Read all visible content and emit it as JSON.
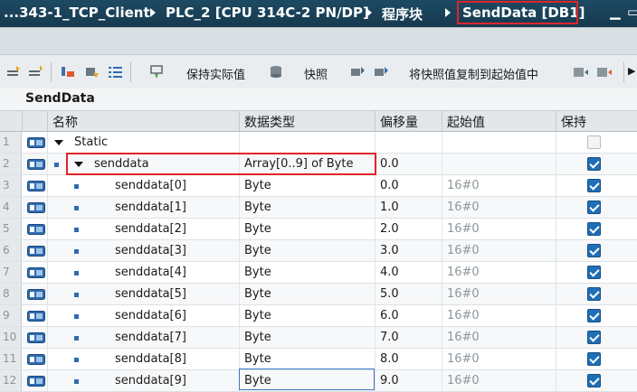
{
  "breadcrumb": {
    "items": [
      "...343-1_TCP_Client",
      "PLC_2 [CPU 314C-2 PN/DP]",
      "程序块",
      "SendData [DB1]"
    ]
  },
  "toolbar": {
    "keep_actual_label": "保持实际值",
    "snapshot_label": "快照",
    "copy_snapshot_label": "将快照值复制到起始值中"
  },
  "block": {
    "name": "SendData"
  },
  "table": {
    "headers": {
      "name": "名称",
      "datatype": "数据类型",
      "offset": "偏移量",
      "start": "起始值",
      "retain": "保持"
    },
    "rows": [
      {
        "num": "1",
        "name": "Static",
        "type": "",
        "offset": "",
        "start": "",
        "retain": false
      },
      {
        "num": "2",
        "name": "senddata",
        "type": "Array[0..9] of Byte",
        "offset": "0.0",
        "start": "",
        "retain": true
      },
      {
        "num": "3",
        "name": "senddata[0]",
        "type": "Byte",
        "offset": "0.0",
        "start": "16#0",
        "retain": true
      },
      {
        "num": "4",
        "name": "senddata[1]",
        "type": "Byte",
        "offset": "1.0",
        "start": "16#0",
        "retain": true
      },
      {
        "num": "5",
        "name": "senddata[2]",
        "type": "Byte",
        "offset": "2.0",
        "start": "16#0",
        "retain": true
      },
      {
        "num": "6",
        "name": "senddata[3]",
        "type": "Byte",
        "offset": "3.0",
        "start": "16#0",
        "retain": true
      },
      {
        "num": "7",
        "name": "senddata[4]",
        "type": "Byte",
        "offset": "4.0",
        "start": "16#0",
        "retain": true
      },
      {
        "num": "8",
        "name": "senddata[5]",
        "type": "Byte",
        "offset": "5.0",
        "start": "16#0",
        "retain": true
      },
      {
        "num": "9",
        "name": "senddata[6]",
        "type": "Byte",
        "offset": "6.0",
        "start": "16#0",
        "retain": true
      },
      {
        "num": "10",
        "name": "senddata[7]",
        "type": "Byte",
        "offset": "7.0",
        "start": "16#0",
        "retain": true
      },
      {
        "num": "11",
        "name": "senddata[8]",
        "type": "Byte",
        "offset": "8.0",
        "start": "16#0",
        "retain": true
      },
      {
        "num": "12",
        "name": "senddata[9]",
        "type": "Byte",
        "offset": "9.0",
        "start": "16#0",
        "retain": true
      }
    ]
  },
  "colors": {
    "titlebar": "#1d4a63",
    "highlight": "#e0242b",
    "checkbox": "#1f6fb8"
  }
}
